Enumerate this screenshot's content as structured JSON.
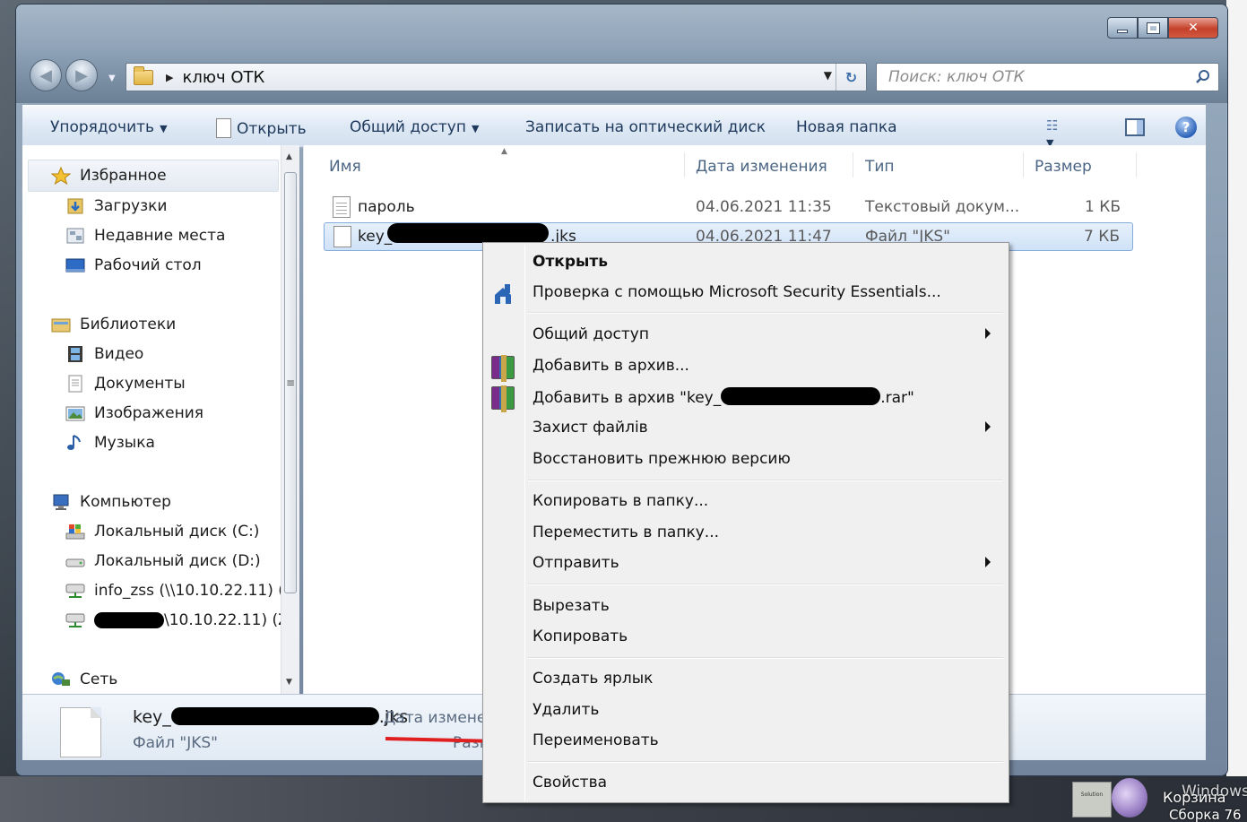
{
  "window": {
    "address_path": "ключ ОТК",
    "search_placeholder": "Поиск: ключ ОТК"
  },
  "toolbar": {
    "organize": "Упорядочить",
    "open": "Открыть",
    "share": "Общий доступ",
    "burn": "Записать на оптический диск",
    "new_folder": "Новая папка"
  },
  "nav": {
    "favorites": "Избранное",
    "downloads": "Загрузки",
    "recent": "Недавние места",
    "desktop": "Рабочий стол",
    "libraries": "Библиотеки",
    "video": "Видео",
    "documents": "Документы",
    "images": "Изображения",
    "music": "Музыка",
    "computer": "Компьютер",
    "disk_c": "Локальный диск (C:)",
    "disk_d": "Локальный диск (D:)",
    "net_drive_1": "info_zss (\\\\10.10.22.11) (",
    "net_drive_2": "\\10.10.22.11) (Z",
    "network": "Сеть"
  },
  "columns": {
    "name": "Имя",
    "date": "Дата изменения",
    "type": "Тип",
    "size": "Размер"
  },
  "files": [
    {
      "name": "пароль",
      "date": "04.06.2021 11:35",
      "type": "Текстовый докум...",
      "size": "1 КБ"
    },
    {
      "name_prefix": "key_",
      "name_suffix": ".jks",
      "date": "04.06.2021 11:47",
      "type": "Файл \"JKS\"",
      "size": "7 КБ"
    }
  ],
  "details": {
    "name_prefix": "key_",
    "name_suffix": ".jks",
    "date_label": "Дата измене",
    "type": "Файл \"JKS\"",
    "size_label": "Разм"
  },
  "context_menu": {
    "open": "Открыть",
    "mse_scan": "Проверка с помощью Microsoft Security Essentials...",
    "share": "Общий доступ",
    "add_archive": "Добавить в архив...",
    "add_archive_named_prefix": "Добавить в архив \"key_",
    "add_archive_named_suffix": ".rar\"",
    "protect": "Захист файлів",
    "restore": "Восстановить прежнюю версию",
    "copy_to": "Копировать в папку...",
    "move_to": "Переместить в папку...",
    "send_to": "Отправить",
    "cut": "Вырезать",
    "copy": "Копировать",
    "shortcut": "Создать ярлык",
    "delete": "Удалить",
    "rename": "Переименовать",
    "properties": "Свойства"
  },
  "desktop": {
    "recycle_bin": "Корзина",
    "windows": "Windows",
    "build": "Сборка 76"
  },
  "colors": {
    "accent_text": "#1e395b",
    "selection_border": "#84acdd",
    "arrow": "#e02020"
  }
}
